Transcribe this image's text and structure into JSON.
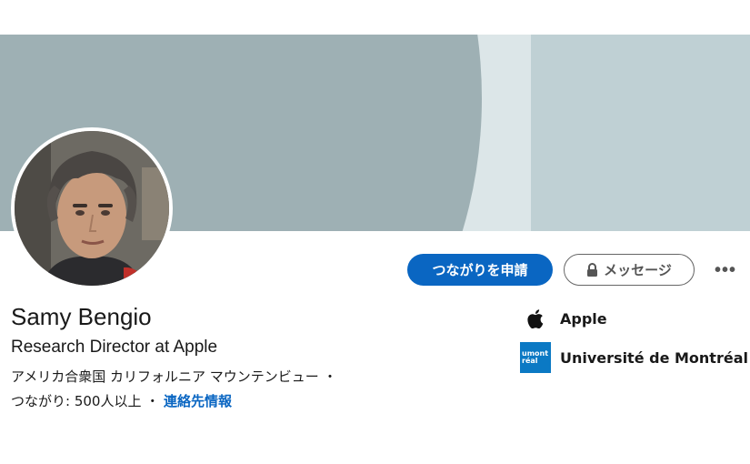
{
  "profile": {
    "name": "Samy Bengio",
    "headline": "Research Director at Apple",
    "location": "アメリカ合衆国 カリフォルニア マウンテンビュー ・",
    "connections": "つながり: 500人以上 ・",
    "contact_info": "連絡先情報"
  },
  "actions": {
    "connect_label": "つながりを申請",
    "message_label": "メッセージ",
    "more_label": "•••"
  },
  "organizations": [
    {
      "name": "Apple",
      "icon": "apple-logo-icon"
    },
    {
      "name": "Université de Montréal",
      "logo_text": [
        "umont",
        "réal"
      ],
      "icon": "udem-logo"
    }
  ],
  "colors": {
    "accent": "#0a66c2",
    "banner_light": "#dce6e8",
    "banner_dark": "#9eb0b4",
    "banner_panel": "#bfd0d4",
    "udem_blue": "#0b79c4"
  }
}
